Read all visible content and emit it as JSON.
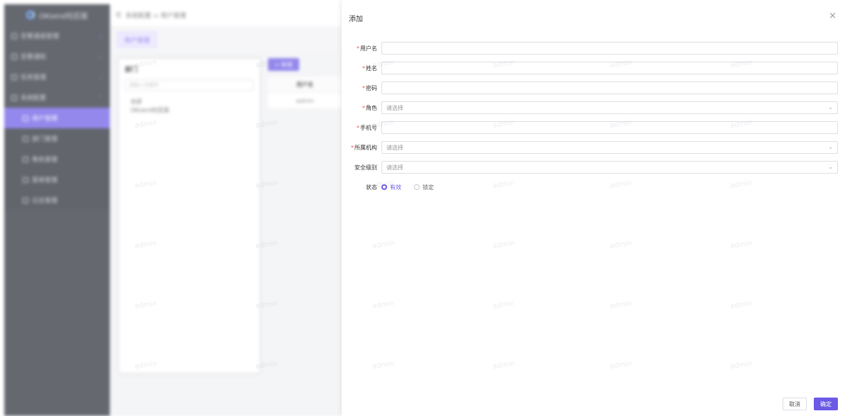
{
  "sidebar": {
    "logo_text": "OKsend社区版",
    "items": [
      {
        "label": "告警通道管理",
        "caret": "⌄"
      },
      {
        "label": "告警通知",
        "caret": "⌄"
      },
      {
        "label": "任务管理",
        "caret": "⌄"
      },
      {
        "label": "系统配置",
        "caret": "⌃"
      },
      {
        "label": "用户管理",
        "caret": ""
      },
      {
        "label": "部门管理",
        "caret": ""
      },
      {
        "label": "角色管理",
        "caret": ""
      },
      {
        "label": "菜单管理",
        "caret": ""
      },
      {
        "label": "日志管理",
        "caret": ""
      }
    ]
  },
  "topbar": {
    "breadcrumb": "系统配置 > 用户管理"
  },
  "tabs": [
    {
      "label": "用户管理"
    }
  ],
  "dept_panel": {
    "title": "部门",
    "search_placeholder": "请输入关键字",
    "tree": [
      "全部",
      "OKsend社区版"
    ]
  },
  "user_table": {
    "add_label": "+ 新增",
    "header": "用户名",
    "rows": [
      "admin"
    ]
  },
  "watermark": "admin",
  "drawer": {
    "title": "添加",
    "close_icon": "×",
    "fields": {
      "username": {
        "label": "用户名",
        "required": true,
        "value": ""
      },
      "name": {
        "label": "姓名",
        "required": true,
        "value": ""
      },
      "password": {
        "label": "密码",
        "required": true,
        "value": ""
      },
      "role": {
        "label": "角色",
        "required": true,
        "placeholder": "请选择"
      },
      "phone": {
        "label": "手机号",
        "required": true,
        "value": ""
      },
      "org": {
        "label": "所属机构",
        "required": true,
        "placeholder": "请选择"
      },
      "security": {
        "label": "安全级别",
        "required": false,
        "placeholder": "请选择"
      }
    },
    "status": {
      "label": "状态",
      "options": [
        {
          "label": "有效",
          "checked": true
        },
        {
          "label": "锁定",
          "checked": false
        }
      ]
    },
    "cancel_label": "取消",
    "ok_label": "确定"
  },
  "colors": {
    "accent": "#6b5ae6",
    "sidebar_bg": "#2b2f3a",
    "required_star": "#f25656"
  }
}
